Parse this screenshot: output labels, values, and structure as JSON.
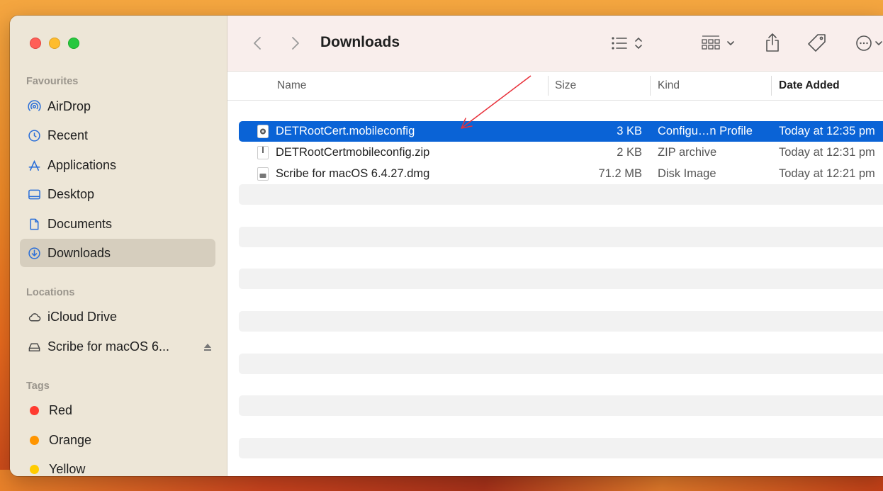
{
  "sidebar": {
    "favourites_title": "Favourites",
    "favourites": [
      {
        "label": "AirDrop",
        "icon": "airdrop-icon"
      },
      {
        "label": "Recent",
        "icon": "clock-icon"
      },
      {
        "label": "Applications",
        "icon": "applications-icon"
      },
      {
        "label": "Desktop",
        "icon": "desktop-icon"
      },
      {
        "label": "Documents",
        "icon": "document-icon"
      },
      {
        "label": "Downloads",
        "icon": "download-icon",
        "selected": true
      }
    ],
    "locations_title": "Locations",
    "locations": [
      {
        "label": "iCloud Drive",
        "icon": "cloud-icon"
      },
      {
        "label": "Scribe for macOS 6...",
        "icon": "disk-icon",
        "ejectable": true
      }
    ],
    "tags_title": "Tags",
    "tags": [
      {
        "label": "Red",
        "color": "#ff3b30"
      },
      {
        "label": "Orange",
        "color": "#ff9500"
      },
      {
        "label": "Yellow",
        "color": "#ffcc00"
      }
    ]
  },
  "toolbar": {
    "title": "Downloads",
    "back_icon": "chevron-left-icon",
    "forward_icon": "chevron-right-icon",
    "view_icon": "list-view-icon",
    "group_icon": "group-icon",
    "share_icon": "share-icon",
    "tag_icon": "tag-icon",
    "more_icon": "more-icon"
  },
  "columns": {
    "name": "Name",
    "size": "Size",
    "kind": "Kind",
    "date_added": "Date Added"
  },
  "files": [
    {
      "name": "DETRootCert.mobileconfig",
      "size": "3 KB",
      "kind": "Configu…n Profile",
      "date": "Today at 12:35 pm",
      "selected": true
    },
    {
      "name": "DETRootCertmobileconfig.zip",
      "size": "2 KB",
      "kind": "ZIP archive",
      "date": "Today at 12:31 pm"
    },
    {
      "name": "Scribe for macOS 6.4.27.dmg",
      "size": "71.2 MB",
      "kind": "Disk Image",
      "date": "Today at 12:21 pm"
    }
  ],
  "colors": {
    "selection": "#0a63d6",
    "annotation_arrow": "#e8303a",
    "sidebar_bg": "#ede6d7"
  }
}
